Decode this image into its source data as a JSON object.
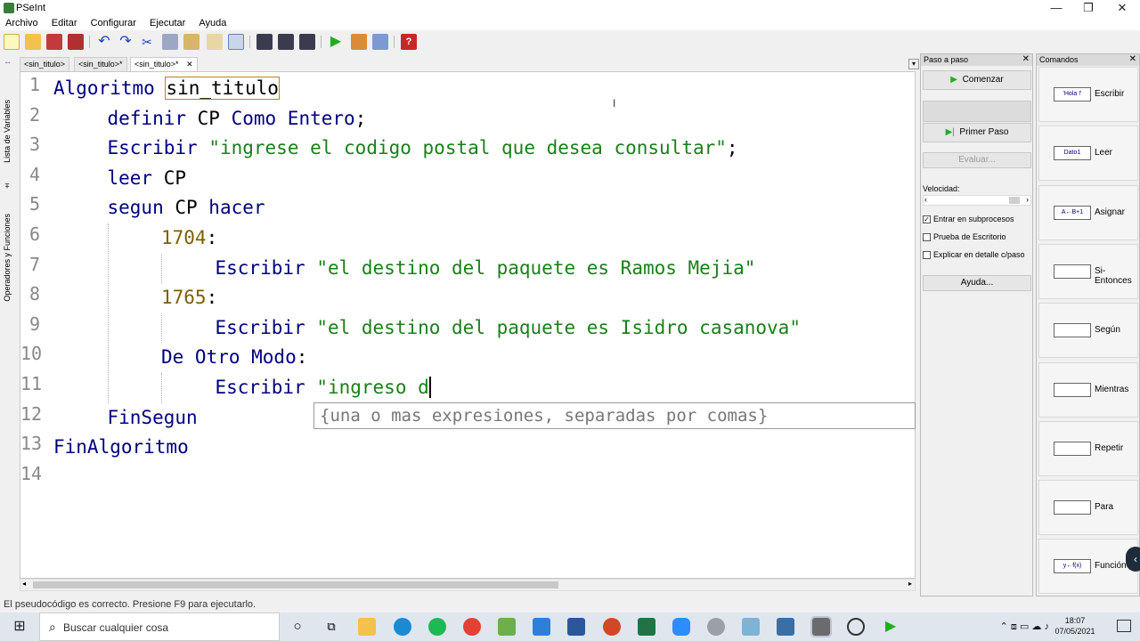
{
  "window": {
    "title": "PSeInt",
    "controls": [
      "—",
      "❐",
      "✕"
    ]
  },
  "menu": [
    "Archivo",
    "Editar",
    "Configurar",
    "Ejecutar",
    "Ayuda"
  ],
  "left_strip": {
    "variables_label": "Lista de Variables",
    "operators_label": "Operadores y Funciones"
  },
  "tabs": [
    "<sin_titulo>",
    "<sin_titulo>*",
    "<sin_titulo>*"
  ],
  "editor": {
    "lines": [
      {
        "num": "1",
        "parts": [
          [
            "kw",
            "Algoritmo"
          ],
          [
            "ident",
            " "
          ],
          [
            "ident",
            "sin_titulo"
          ]
        ]
      },
      {
        "num": "2",
        "parts": [
          [
            "kw",
            "definir"
          ],
          [
            "ident",
            " CP "
          ],
          [
            "kw",
            "Como Entero"
          ],
          [
            "ident",
            ";"
          ]
        ]
      },
      {
        "num": "3",
        "parts": [
          [
            "kw",
            "Escribir"
          ],
          [
            "ident",
            " "
          ],
          [
            "str",
            "\"ingrese el codigo postal que desea consultar\""
          ],
          [
            "ident",
            ";"
          ]
        ]
      },
      {
        "num": "4",
        "parts": [
          [
            "kw",
            "leer"
          ],
          [
            "ident",
            " CP"
          ]
        ]
      },
      {
        "num": "5",
        "parts": [
          [
            "kw",
            "segun"
          ],
          [
            "ident",
            " CP "
          ],
          [
            "kw",
            "hacer"
          ]
        ]
      },
      {
        "num": "6",
        "parts": [
          [
            "num",
            "1704"
          ],
          [
            "ident",
            ":"
          ]
        ]
      },
      {
        "num": "7",
        "parts": [
          [
            "kw",
            "Escribir"
          ],
          [
            "ident",
            " "
          ],
          [
            "str",
            "\"el destino del paquete es Ramos Mejia\""
          ]
        ]
      },
      {
        "num": "8",
        "parts": [
          [
            "num",
            "1765"
          ],
          [
            "ident",
            ":"
          ]
        ]
      },
      {
        "num": "9",
        "parts": [
          [
            "kw",
            "Escribir"
          ],
          [
            "ident",
            " "
          ],
          [
            "str",
            "\"el destino del paquete es Isidro casanova\""
          ]
        ]
      },
      {
        "num": "10",
        "parts": [
          [
            "kw",
            "De Otro Modo"
          ],
          [
            "ident",
            ":"
          ]
        ]
      },
      {
        "num": "11",
        "parts": [
          [
            "kw",
            "Escribir"
          ],
          [
            "ident",
            " "
          ],
          [
            "str",
            "\"ingreso d"
          ]
        ]
      },
      {
        "num": "12",
        "parts": [
          [
            "kw",
            "FinSegun"
          ]
        ]
      },
      {
        "num": "13",
        "parts": [
          [
            "kw",
            "FinAlgoritmo"
          ]
        ]
      },
      {
        "num": "14",
        "parts": []
      }
    ],
    "autocomplete": "{una o mas expresiones, separadas por comas}"
  },
  "status": "El pseudocódigo es correcto. Presione F9 para ejecutarlo.",
  "paso_panel": {
    "title": "Paso a paso",
    "comenzar": "Comenzar",
    "primer_paso": "Primer Paso",
    "evaluar": "Evaluar...",
    "velocidad": "Velocidad:",
    "checks": [
      {
        "label": "Entrar en subprocesos",
        "checked": true
      },
      {
        "label": "Prueba de Escritorio",
        "checked": false
      },
      {
        "label": "Explicar en detalle c/paso",
        "checked": false
      }
    ],
    "ayuda": "Ayuda..."
  },
  "comandos_panel": {
    "title": "Comandos",
    "items": [
      {
        "label": "Escribir",
        "icon_text": "'Hola !'"
      },
      {
        "label": "Leer",
        "icon_text": "Dato1"
      },
      {
        "label": "Asignar",
        "icon_text": "A←B+1"
      },
      {
        "label": "Si-Entonces",
        "icon_text": ""
      },
      {
        "label": "Según",
        "icon_text": ""
      },
      {
        "label": "Mientras",
        "icon_text": ""
      },
      {
        "label": "Repetir",
        "icon_text": ""
      },
      {
        "label": "Para",
        "icon_text": ""
      },
      {
        "label": "Función",
        "icon_text": "y←f(x)"
      }
    ]
  },
  "taskbar": {
    "search_placeholder": "Buscar cualquier cosa",
    "time": "18:07",
    "date": "07/05/2021"
  },
  "colors": {
    "keyword": "#00007f",
    "string": "#1a7f1a",
    "number": "#7f5f00",
    "run_green": "#1fae1f"
  }
}
